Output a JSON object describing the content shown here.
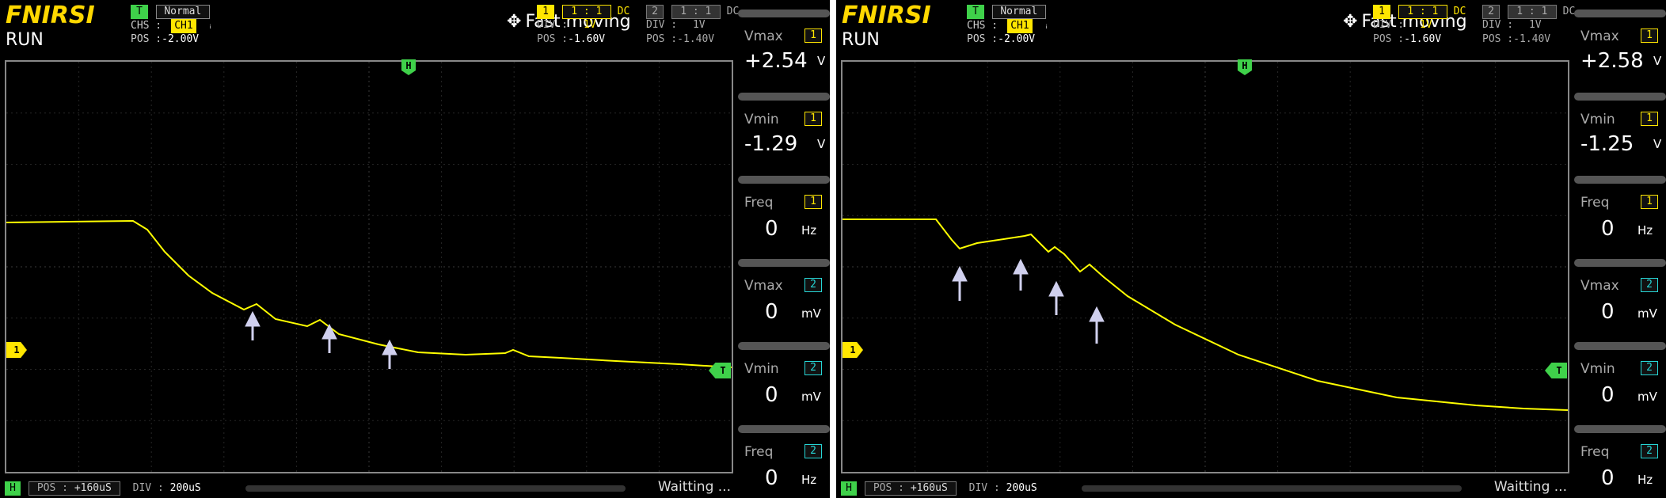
{
  "screens": [
    {
      "brand": "FNIRSI",
      "run_state": "RUN",
      "trigger": {
        "badge": "T",
        "mode": "Normal",
        "chs_label": "CHS :",
        "chs_value": "CH1",
        "edge_icon": "rising-edge-icon",
        "edge_glyph": "ꜟ",
        "pos_label": "POS :",
        "pos_value": "-2.00V"
      },
      "mode_icon": "move-arrows-icon",
      "mode_text": "Fast moving",
      "ch1": {
        "badge": "1",
        "ratio": "1 : 1",
        "coupling": "DC",
        "div_label": "DIV :",
        "div_value": "1V",
        "pos_label": "POS :",
        "pos_value": "-1.60V"
      },
      "ch2": {
        "badge": "2",
        "ratio": "1 : 1",
        "coupling": "DC",
        "div_label": "DIV :",
        "div_value": "1V",
        "pos_label": "POS :",
        "pos_value": "-1.40V"
      },
      "measurements": [
        {
          "label": "Vmax",
          "channel": "1",
          "value": "+2.54",
          "unit": "V",
          "zero": false
        },
        {
          "label": "Vmin",
          "channel": "1",
          "value": "-1.29",
          "unit": "V",
          "zero": false
        },
        {
          "label": "Freq",
          "channel": "1",
          "value": "0",
          "unit": "Hz",
          "zero": true
        },
        {
          "label": "Vmax",
          "channel": "2",
          "value": "0",
          "unit": "mV",
          "zero": true
        },
        {
          "label": "Vmin",
          "channel": "2",
          "value": "0",
          "unit": "mV",
          "zero": true
        },
        {
          "label": "Freq",
          "channel": "2",
          "value": "0",
          "unit": "Hz",
          "zero": true
        }
      ],
      "bottom": {
        "h_badge": "H",
        "pos_label": "POS :",
        "pos_value": "+160uS",
        "div_label": "DIV :",
        "div_value": "200uS",
        "status": "Waitting ..."
      },
      "markers": {
        "h": "H",
        "ch1": "1",
        "t": "T"
      },
      "colors": {
        "trace": "#ffff00",
        "ch1": "#ffe600",
        "ch2": "#26d7d7",
        "trigger": "#3fd14a",
        "annotation_arrow": "#d0d0ee"
      }
    },
    {
      "brand": "FNIRSI",
      "run_state": "RUN",
      "trigger": {
        "badge": "T",
        "mode": "Normal",
        "chs_label": "CHS :",
        "chs_value": "CH1",
        "edge_icon": "rising-edge-icon",
        "edge_glyph": "ꜟ",
        "pos_label": "POS :",
        "pos_value": "-2.00V"
      },
      "mode_icon": "move-arrows-icon",
      "mode_text": "Fast moving",
      "ch1": {
        "badge": "1",
        "ratio": "1 : 1",
        "coupling": "DC",
        "div_label": "DIV :",
        "div_value": "1V",
        "pos_label": "POS :",
        "pos_value": "-1.60V"
      },
      "ch2": {
        "badge": "2",
        "ratio": "1 : 1",
        "coupling": "DC",
        "div_label": "DIV :",
        "div_value": "1V",
        "pos_label": "POS :",
        "pos_value": "-1.40V"
      },
      "measurements": [
        {
          "label": "Vmax",
          "channel": "1",
          "value": "+2.58",
          "unit": "V",
          "zero": false
        },
        {
          "label": "Vmin",
          "channel": "1",
          "value": "-1.25",
          "unit": "V",
          "zero": false
        },
        {
          "label": "Freq",
          "channel": "1",
          "value": "0",
          "unit": "Hz",
          "zero": true
        },
        {
          "label": "Vmax",
          "channel": "2",
          "value": "0",
          "unit": "mV",
          "zero": true
        },
        {
          "label": "Vmin",
          "channel": "2",
          "value": "0",
          "unit": "mV",
          "zero": true
        },
        {
          "label": "Freq",
          "channel": "2",
          "value": "0",
          "unit": "Hz",
          "zero": true
        }
      ],
      "bottom": {
        "h_badge": "H",
        "pos_label": "POS :",
        "pos_value": "+160uS",
        "div_label": "DIV :",
        "div_value": "200uS",
        "status": "Waitting ..."
      },
      "markers": {
        "h": "H",
        "ch1": "1",
        "t": "T"
      },
      "colors": {
        "trace": "#ffff00",
        "ch1": "#ffe600",
        "ch2": "#26d7d7",
        "trigger": "#3fd14a",
        "annotation_arrow": "#d0d0ee"
      }
    }
  ]
}
